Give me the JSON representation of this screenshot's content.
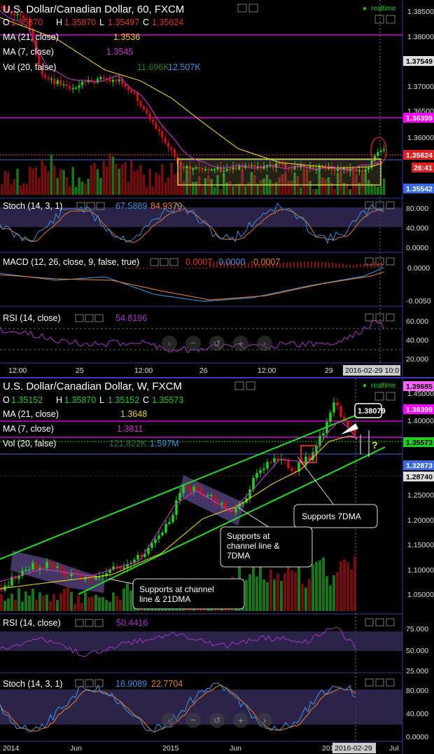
{
  "colors": {
    "bg": "#000000",
    "up": "#22cc22",
    "down": "#cc1111",
    "ma21": "#e6d21e",
    "ma7": "#cc33cc",
    "stochK": "#3a8fe0",
    "stochD": "#e07a2a",
    "macd": "#3a8fe0",
    "signal": "#e07a2a",
    "rsi": "#aa33cc",
    "channel": "#22dd22",
    "magenta": "#ff00ff",
    "band": "#5b4a8a"
  },
  "top": {
    "title": "U.S. Dollar/Canadian Dollar, 60, FXCM",
    "realtime": "realtime",
    "ohlc": {
      "o_label": "O",
      "o": "1.35870",
      "h_label": "H",
      "h": "1.35870",
      "l_label": "L",
      "l": "1.35497",
      "c_label": "C",
      "c": "1.35624"
    },
    "ma21_label": "MA (21, close)",
    "ma21_value": "1.3536",
    "ma7_label": "MA (7, close)",
    "ma7_value": "1.3545",
    "vol_label": "Vol (20, false)",
    "vol_value1": "11.696K",
    "vol_value2": "12.507K",
    "stoch_label": "Stoch (14, 3, 1)",
    "stoch_k": "67.5889",
    "stoch_d": "84.9379",
    "macd_label": "MACD (12, 26, close, 9, false, true)",
    "macd_v1": "0.0007",
    "macd_v2": "0.0000",
    "macd_v3": "-0.0007",
    "rsi_label": "RSI (14, close)",
    "rsi_value": "54.8196",
    "price_axis": [
      "1.38500",
      "1.38000",
      "1.37500",
      "1.37000",
      "1.36500",
      "1.36000",
      "1.35500"
    ],
    "price_badges": {
      "b1": "1.37549",
      "b2": "1.36399",
      "b3": "1.35624",
      "b4": "26:41",
      "b5": "1.35542"
    },
    "stoch_axis": [
      "80.000",
      "40.000",
      "0.0000"
    ],
    "macd_axis": [
      "0.0000",
      "-0.0050"
    ],
    "rsi_axis": [
      "60.000",
      "40.000",
      "20.000"
    ],
    "x_axis": [
      "12:00",
      "25",
      "12:00",
      "26",
      "12:00",
      "29"
    ],
    "x_badge": "2016-02-29 10:0"
  },
  "bottom": {
    "title": "U.S. Dollar/Canadian Dollar, W, FXCM",
    "realtime": "realtime",
    "ohlc": {
      "o_label": "O",
      "o": "1.35152",
      "h_label": "H",
      "h": "1.35870",
      "l_label": "L",
      "l": "1.35152",
      "c_label": "C",
      "c": "1.35573"
    },
    "ma21_label": "MA (21, close)",
    "ma21_value": "1.3648",
    "ma7_label": "MA (7, close)",
    "ma7_value": "1.3811",
    "vol_label": "Vol (20, false)",
    "vol_value1": "121.822K",
    "vol_value2": "1.597M",
    "rsi_label": "RSI (14, close)",
    "rsi_value": "50.4416",
    "stoch_label": "Stoch (14, 3, 1)",
    "stoch_k": "18.9089",
    "stoch_d": "22.7704",
    "price_axis": [
      "1.45000",
      "1.40000",
      "1.35000",
      "1.30000",
      "1.25000",
      "1.20000",
      "1.15000",
      "1.10000",
      "1.05000"
    ],
    "price_badges": {
      "b1": "1.39685",
      "b2": "1.36399",
      "b3": "1.35573",
      "b4": "1.32873",
      "b5": "1.28740"
    },
    "callout": "1.38079",
    "question": "?",
    "rsi_axis": [
      "75.000",
      "50.000",
      "25.000"
    ],
    "stoch_axis": [
      "80.000",
      "40.000",
      "0.0000"
    ],
    "x_axis": [
      "2014",
      "Jun",
      "2015",
      "Jun",
      "201"
    ],
    "x_badge": "2016-02-29",
    "x_last": "Jul",
    "annotations": {
      "a1": "Supports 7DMA",
      "a2_l1": "Supports at",
      "a2_l2": "channel line &",
      "a2_l3": "7DMA",
      "a3_l1": "Supports at channel",
      "a3_l2": "line & 21DMA"
    }
  },
  "chart_data": [
    {
      "type": "line",
      "title": "U.S. Dollar/Canadian Dollar, 60, FXCM",
      "xlabel": "",
      "ylabel": "",
      "ylim": [
        1.3554,
        1.3865
      ],
      "x": [
        "12:00",
        "25",
        "12:00",
        "26",
        "12:00",
        "29"
      ],
      "series": [
        {
          "name": "MA (21, close)",
          "values": [
            1.3842,
            1.3772,
            1.3748,
            1.3641,
            1.3578,
            1.3555,
            1.355,
            1.3548,
            1.3536
          ]
        },
        {
          "name": "MA (7, close)",
          "values": [
            1.3848,
            1.3705,
            1.3726,
            1.3601,
            1.3562,
            1.3556,
            1.3559,
            1.3551,
            1.3545
          ]
        }
      ]
    },
    {
      "type": "line",
      "title": "U.S. Dollar/Canadian Dollar, W, FXCM",
      "xlabel": "",
      "ylabel": "",
      "ylim": [
        1.03,
        1.47
      ],
      "x": [
        "2014",
        "Jun",
        "2015",
        "Jun",
        "201"
      ],
      "series": [
        {
          "name": "MA (21, close)",
          "values": [
            1.065,
            1.078,
            1.093,
            1.13,
            1.185,
            1.225,
            1.27,
            1.31,
            1.365,
            1.3648
          ]
        },
        {
          "name": "MA (7, close)",
          "values": [
            1.07,
            1.085,
            1.1,
            1.16,
            1.23,
            1.22,
            1.3,
            1.33,
            1.41,
            1.3811
          ]
        }
      ]
    }
  ]
}
